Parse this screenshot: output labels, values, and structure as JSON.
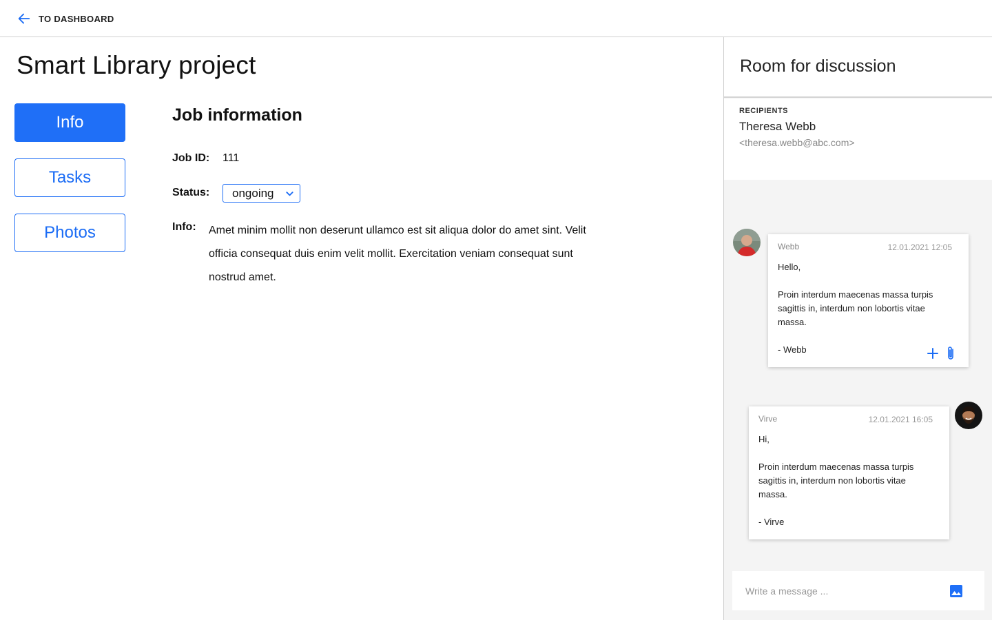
{
  "header": {
    "back_label": "TO DASHBOARD"
  },
  "page": {
    "title": "Smart Library project"
  },
  "nav": {
    "items": [
      {
        "label": "Info",
        "active": true
      },
      {
        "label": "Tasks",
        "active": false
      },
      {
        "label": "Photos",
        "active": false
      }
    ]
  },
  "job": {
    "section_title": "Job information",
    "id_label": "Job ID:",
    "id_value": "111",
    "status_label": "Status:",
    "status_value": "ongoing",
    "info_label": "Info:",
    "info_text": "Amet minim mollit non deserunt ullamco est sit aliqua dolor do amet sint. Velit officia consequat duis enim velit mollit. Exercitation veniam consequat sunt nostrud amet."
  },
  "discussion": {
    "title": "Room for discussion",
    "recipients_label": "RECIPIENTS",
    "recipient_name": "Theresa Webb",
    "recipient_email": "<theresa.webb@abc.com>",
    "messages": [
      {
        "author": "Webb",
        "time": "12.01.2021 12:05",
        "body": "Hello,\n\nProin interdum maecenas massa turpis sagittis in, interdum non lobortis vitae massa.\n\n- Webb"
      },
      {
        "author": "Virve",
        "time": "12.01.2021 16:05",
        "body": "Hi,\n\nProin interdum maecenas massa turpis sagittis in, interdum non lobortis vitae massa.\n\n- Virve"
      }
    ],
    "composer_placeholder": "Write a message ..."
  },
  "icons": {
    "back": "arrow-left-icon",
    "status_dropdown": "chevron-down-icon",
    "add": "plus-icon",
    "attach": "paperclip-icon",
    "image": "image-icon"
  },
  "colors": {
    "accent": "#1f6ff7",
    "panel_bg": "#f4f4f4"
  }
}
